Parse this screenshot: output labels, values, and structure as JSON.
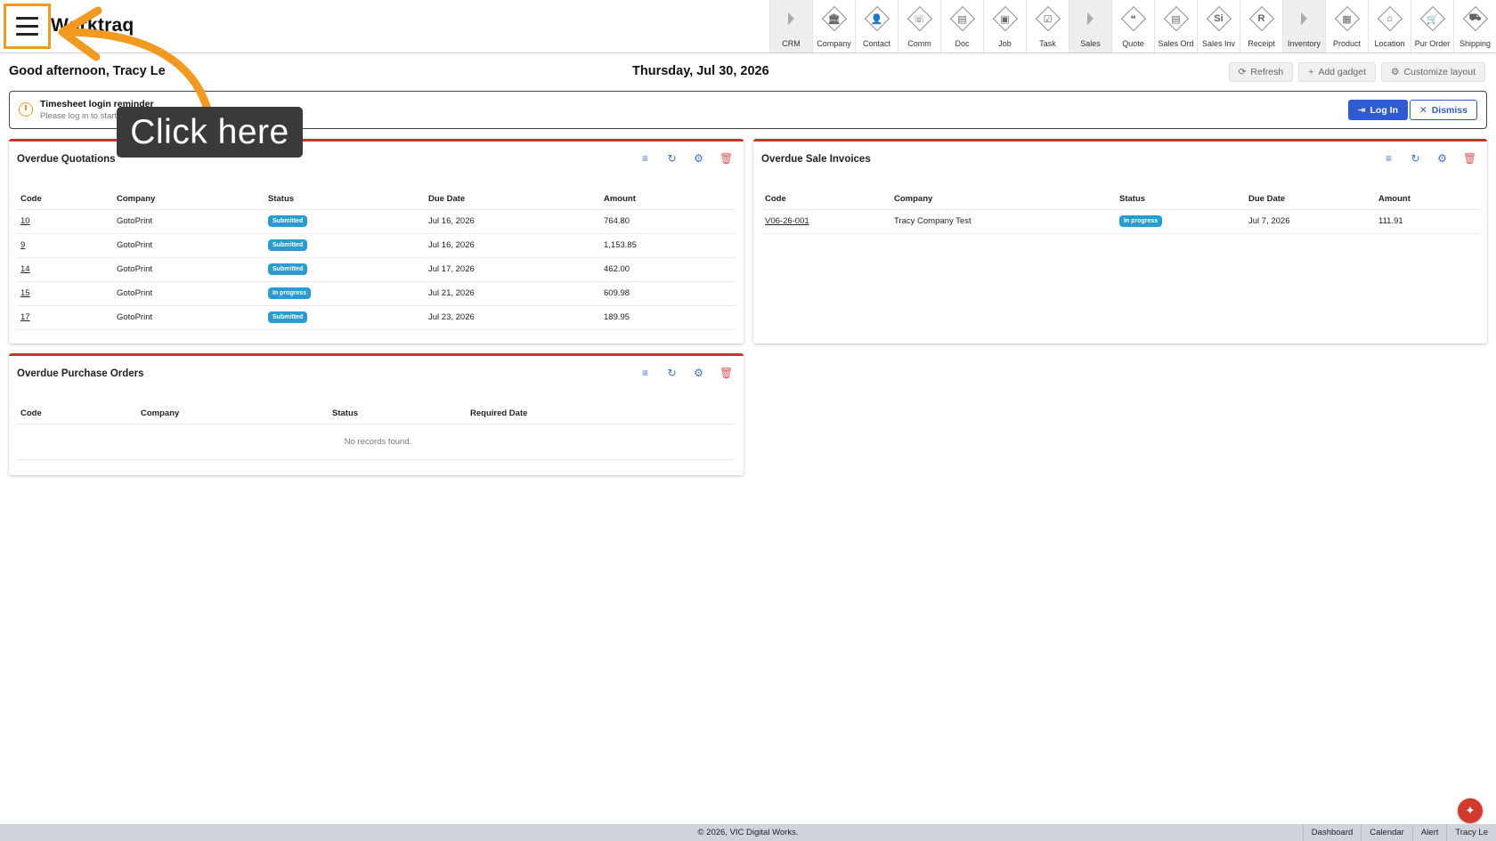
{
  "app": {
    "title": "Worktraq"
  },
  "nav": [
    {
      "label": "CRM",
      "icon": "triangle-right-icon",
      "group": true,
      "glyph": ""
    },
    {
      "label": "Company",
      "icon": "company-icon",
      "group": false,
      "glyph": "🏛"
    },
    {
      "label": "Contact",
      "icon": "contact-icon",
      "group": false,
      "glyph": "👤"
    },
    {
      "label": "Comm",
      "icon": "comm-icon",
      "group": false,
      "glyph": "☏"
    },
    {
      "label": "Doc",
      "icon": "doc-icon",
      "group": false,
      "glyph": "▤"
    },
    {
      "label": "Job",
      "icon": "job-icon",
      "group": false,
      "glyph": "▣"
    },
    {
      "label": "Task",
      "icon": "task-icon",
      "group": false,
      "glyph": "☑"
    },
    {
      "label": "Sales",
      "icon": "triangle-right-icon",
      "group": true,
      "glyph": ""
    },
    {
      "label": "Quote",
      "icon": "quote-icon",
      "group": false,
      "glyph": "❝"
    },
    {
      "label": "Sales Ord",
      "icon": "sales-order-icon",
      "group": false,
      "glyph": "▤"
    },
    {
      "label": "Sales Inv",
      "icon": "sales-invoice-icon",
      "group": false,
      "glyph": "Si"
    },
    {
      "label": "Receipt",
      "icon": "receipt-icon",
      "group": false,
      "glyph": "R"
    },
    {
      "label": "Inventory",
      "icon": "triangle-right-icon",
      "group": true,
      "glyph": ""
    },
    {
      "label": "Product",
      "icon": "product-icon",
      "group": false,
      "glyph": "▦"
    },
    {
      "label": "Location",
      "icon": "location-icon",
      "group": false,
      "glyph": "⌂"
    },
    {
      "label": "Pur Order",
      "icon": "purchase-order-icon",
      "group": false,
      "glyph": "🛒"
    },
    {
      "label": "Shipping",
      "icon": "shipping-icon",
      "group": false,
      "glyph": "⛟"
    }
  ],
  "header": {
    "greeting": "Good afternoon, Tracy Le",
    "date": "Thursday, Jul 30, 2026",
    "actions": {
      "refresh": "Refresh",
      "add_gadget": "Add gadget",
      "customize": "Customize layout"
    }
  },
  "reminder": {
    "title": "Timesheet login reminder",
    "text": "Please log in to start tracking your working hours for today.",
    "login": "Log In",
    "dismiss": "Dismiss"
  },
  "quotations": {
    "title": "Overdue Quotations",
    "columns": [
      "Code",
      "Company",
      "Status",
      "Due Date",
      "Amount"
    ],
    "rows": [
      {
        "code": "10",
        "company": "GotoPrint",
        "status": "Submitted",
        "due": "Jul 16, 2026",
        "amount": "764.80"
      },
      {
        "code": "9",
        "company": "GotoPrint",
        "status": "Submitted",
        "due": "Jul 16, 2026",
        "amount": "1,153.85"
      },
      {
        "code": "14",
        "company": "GotoPrint",
        "status": "Submitted",
        "due": "Jul 17, 2026",
        "amount": "462.00"
      },
      {
        "code": "15",
        "company": "GotoPrint",
        "status": "In progress",
        "due": "Jul 21, 2026",
        "amount": "609.98"
      },
      {
        "code": "17",
        "company": "GotoPrint",
        "status": "Submitted",
        "due": "Jul 23, 2026",
        "amount": "189.95"
      }
    ]
  },
  "invoices": {
    "title": "Overdue Sale Invoices",
    "columns": [
      "Code",
      "Company",
      "Status",
      "Due Date",
      "Amount"
    ],
    "rows": [
      {
        "code": "V06-26-001",
        "company": "Tracy Company Test",
        "status": "In progress",
        "due": "Jul 7, 2026",
        "amount": "111.91"
      }
    ]
  },
  "purchase_orders": {
    "title": "Overdue Purchase Orders",
    "columns": [
      "Code",
      "Company",
      "Status",
      "Required Date"
    ],
    "empty": "No records found."
  },
  "overlay": {
    "tooltip": "Click here"
  },
  "footer": {
    "copyright": "© 2026, VIC Digital Works.",
    "links": [
      "Dashboard",
      "Calendar",
      "Alert",
      "Tracy Le"
    ]
  },
  "colors": {
    "accent": "#f29a1f",
    "primary": "#2f5bd2",
    "panel_border": "#c0392b",
    "badge": "#2a9bd0"
  }
}
